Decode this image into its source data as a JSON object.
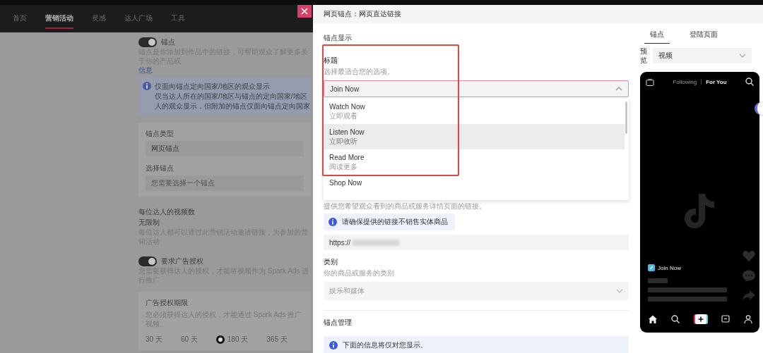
{
  "top_nav": [
    {
      "label": "首页",
      "selected": false
    },
    {
      "label": "营销活动",
      "selected": true
    },
    {
      "label": "灵感",
      "selected": false
    },
    {
      "label": "达人广场",
      "selected": false
    },
    {
      "label": "工具",
      "selected": false
    }
  ],
  "background_form": {
    "anchor_toggle": {
      "label": "锚点",
      "on": true
    },
    "anchor_description": "锚点是你添加到作品中的链接，可帮助观众了解更多关于你的产品或",
    "anchor_link": "信息",
    "notice": {
      "title": "仅面向锚点定向国家/地区的观众显示",
      "lines": [
        "仅当达人所在的国家/地区与锚点的定向国家/地区",
        "人的观众显示，但附加的锚点仅面向锚点定向国家"
      ]
    },
    "anchor_type": {
      "label": "锚点类型",
      "value": "网页锚点"
    },
    "select_anchor": {
      "label": "选择锚点",
      "placeholder": "您需要选择一个锚点"
    },
    "videos_per_creator": {
      "label": "每位达人的视频数",
      "value": "无限制",
      "description": "每位达人都可以通过此营销活动邀请链接，为参加的营销活动"
    },
    "ad_auth_toggle": {
      "label": "要求广告授权",
      "on": true,
      "description": "您需要获得达人的授权，才能将视频作为 Spark Ads 进行推广"
    },
    "ad_auth_period": {
      "title": "广告授权期限",
      "description": "您必须获得达人的授权，才能通过 Spark Ads 推广视频。",
      "options": [
        {
          "label": "30 天",
          "selected": false
        },
        {
          "label": "60 天",
          "selected": false
        },
        {
          "label": "180 天",
          "selected": true
        },
        {
          "label": "365 天",
          "selected": false
        }
      ]
    }
  },
  "anchor_panel": {
    "header": "网页锚点：网页直达链接",
    "section_title": "锚点显示",
    "title_field": {
      "label": "标题",
      "hint": "选择最适合您的选项。",
      "value": "Join Now",
      "expanded": true,
      "options": [
        {
          "label": "Watch Now",
          "sublabel": "立即观看",
          "highlighted": false
        },
        {
          "label": "Listen Now",
          "sublabel": "立即收听",
          "highlighted": true
        },
        {
          "label": "Read More",
          "sublabel": "阅读更多",
          "highlighted": false
        },
        {
          "label": "Shop Now",
          "highlighted": false
        }
      ]
    },
    "url_hint": "提供您希望观众看到的商品或服务详情页面的链接。",
    "url_notice": "请确保提供的链接不销售实体商品",
    "url_field": {
      "value": "https://"
    },
    "category": {
      "label": "类别",
      "hint": "你的商品或服务的类别",
      "value": "娱乐和媒体",
      "disabled": true
    },
    "management_title": "锚点管理",
    "management_notice": "下面的信息将仅对您显示。"
  },
  "preview_panel": {
    "tabs": [
      {
        "label": "锚点",
        "selected": true
      },
      {
        "label": "登陆页面",
        "selected": false
      }
    ],
    "preview_label": "预览",
    "preview_select": "视频",
    "phone": {
      "feed_tabs": [
        {
          "label": "Following",
          "selected": false
        },
        {
          "label": "For You",
          "selected": true
        }
      ],
      "anchor_label": "Join Now"
    }
  }
}
